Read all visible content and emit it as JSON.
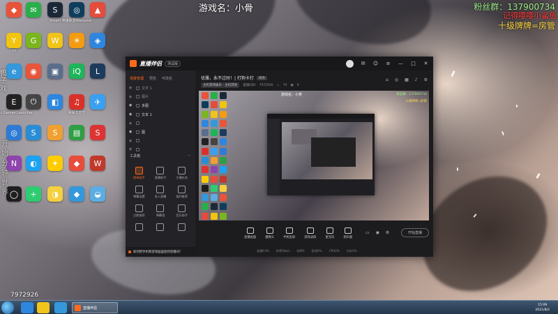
{
  "overlay": {
    "game_name": "游戏名：小骨",
    "fan_group": "粉丝群：137900734",
    "note_red": "记得嘤嘤小鲨鱼",
    "note_level": "十级牌牌=房管",
    "left_vertical_text": "鸭子戏",
    "left_vertical_text_2": "开始分钟世界",
    "room_id": "7972926"
  },
  "desktop_icons": [
    {
      "label": "",
      "color": "#e9533a",
      "glyph": "◆"
    },
    {
      "label": "",
      "color": "#2aae4a",
      "glyph": "✉"
    },
    {
      "label": "Steam",
      "color": "#1b2838",
      "glyph": "S"
    },
    {
      "label": "英雄联盟WeGame",
      "color": "#0e3d5c",
      "glyph": "◎"
    },
    {
      "label": "",
      "color": "#e44c3c",
      "glyph": "▲"
    },
    {
      "label": "YY",
      "color": "#f1c40f",
      "glyph": "Y"
    },
    {
      "label": "",
      "color": "#7ab51d",
      "glyph": "G"
    },
    {
      "label": "",
      "color": "#f0c419",
      "glyph": "W"
    },
    {
      "label": "",
      "color": "#f39c12",
      "glyph": "☀"
    },
    {
      "label": "",
      "color": "#2e86de",
      "glyph": "◈"
    },
    {
      "label": "",
      "color": "#3498db",
      "glyph": "e"
    },
    {
      "label": "",
      "color": "#e8553a",
      "glyph": "◉"
    },
    {
      "label": "",
      "color": "#5a6e8c",
      "glyph": "▣"
    },
    {
      "label": "",
      "color": "#1eb45a",
      "glyph": "iQ"
    },
    {
      "label": "",
      "color": "#1d3b5c",
      "glyph": "L"
    },
    {
      "label": "Epic Games Launcher",
      "color": "#222",
      "glyph": "E"
    },
    {
      "label": "",
      "color": "#444",
      "glyph": "⏻"
    },
    {
      "label": "",
      "color": "#2e86de",
      "glyph": "◧"
    },
    {
      "label": "网易云音乐",
      "color": "#d9312a",
      "glyph": "♫"
    },
    {
      "label": "",
      "color": "#3aa0f0",
      "glyph": "✈"
    },
    {
      "label": "",
      "color": "#2d7bd6",
      "glyph": "◎"
    },
    {
      "label": "",
      "color": "#2a8dd4",
      "glyph": "S"
    },
    {
      "label": "",
      "color": "#f0a030",
      "glyph": "S"
    },
    {
      "label": "",
      "color": "#2f9e44",
      "glyph": "▤"
    },
    {
      "label": "",
      "color": "#d33",
      "glyph": "S"
    },
    {
      "label": "",
      "color": "#8e44ad",
      "glyph": "N"
    },
    {
      "label": "",
      "color": "#1da1f2",
      "glyph": "◐"
    },
    {
      "label": "",
      "color": "#ffcc00",
      "glyph": "✦"
    },
    {
      "label": "",
      "color": "#e74c3c",
      "glyph": "◆"
    },
    {
      "label": "",
      "color": "#c0392b",
      "glyph": "W"
    },
    {
      "label": "",
      "color": "#1e1e1e",
      "glyph": "◯"
    },
    {
      "label": "",
      "color": "#2ecc71",
      "glyph": "+"
    },
    {
      "label": "",
      "color": "#f4d03f",
      "glyph": "◑"
    },
    {
      "label": "",
      "color": "#3498db",
      "glyph": "◆"
    },
    {
      "label": "",
      "color": "#5dade2",
      "glyph": "◒"
    }
  ],
  "app": {
    "logo": "直播伴侣",
    "version": "测试版",
    "left_tabs": [
      "场景管理",
      "预告",
      "可改名"
    ],
    "scenes": [
      {
        "name": "文字 1",
        "visible": false
      },
      {
        "name": "图片",
        "visible": false
      },
      {
        "name": "多图",
        "visible": true
      },
      {
        "name": "文本 1",
        "visible": true
      },
      {
        "name": "",
        "visible": false
      },
      {
        "name": "图",
        "visible": true
      },
      {
        "name": "",
        "visible": false
      },
      {
        "name": "",
        "visible": false
      }
    ],
    "toolbox_title": "工具箱",
    "toolbox_more": "⋯",
    "tools": [
      {
        "label": "榜单助手",
        "hot": true
      },
      {
        "label": "直播助手",
        "hot": false
      },
      {
        "label": "主播任务",
        "hot": false
      },
      {
        "label": "弹幕设置",
        "hot": false
      },
      {
        "label": "进入直播",
        "hot": false
      },
      {
        "label": "福利推荐",
        "hot": false
      },
      {
        "label": "点歌推荐",
        "hot": false
      },
      {
        "label": "弹幕墙",
        "hot": false
      },
      {
        "label": "音乐助手",
        "hot": false
      },
      {
        "label": "",
        "hot": false
      },
      {
        "label": "",
        "hot": false
      },
      {
        "label": "",
        "hot": false
      }
    ],
    "footer_tip": "如何把手机和游戏画面放到直播间？",
    "room_title": "优雅，永不过时！| 打狗卡打",
    "room_edit": "修改",
    "room_meta": {
      "tag": "主机游戏娱乐 · 主机其他",
      "area_label": "直播间ID",
      "room_id": "7972926",
      "likes": "74",
      "viewers": "0"
    },
    "preview": {
      "game_name": "游戏名：小骨",
      "fan_group": "粉丝群：137900734",
      "note_level": "十级牌牌=房管"
    },
    "bottom_tools": [
      "直播画面",
      "摄像头",
      "手机投屏",
      "游戏录屏",
      "麦克风",
      "扬声器"
    ],
    "go_live": "开始直播",
    "stats": [
      "直播0:00",
      "码率0kb/s",
      "帧率0",
      "丢帧0%",
      "CPU0%",
      "内存0%"
    ]
  },
  "taskbar": {
    "active_task": "直播伴侣",
    "time": "15:09",
    "date": "2021/8/2"
  }
}
